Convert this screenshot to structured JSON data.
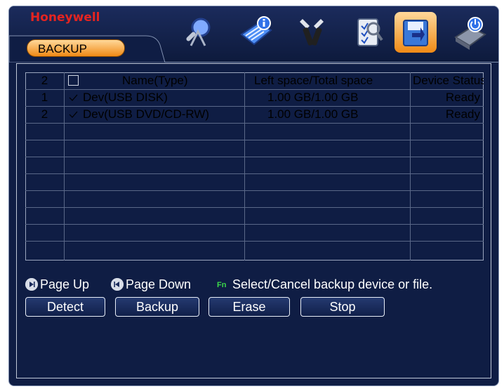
{
  "header": {
    "brand": "Honeywell",
    "tab_label": "BACKUP",
    "icons": [
      "search-icon",
      "info-icon",
      "settings-icon",
      "advanced-icon",
      "backup-icon",
      "shutdown-icon"
    ]
  },
  "table": {
    "header": {
      "index": "2",
      "name": "Name(Type)",
      "space": "Left space/Total space",
      "status": "Device Status"
    },
    "rows": [
      {
        "index": "1",
        "checked": true,
        "name": "Dev(USB DISK)",
        "space": "1.00 GB/1.00 GB",
        "status": "Ready"
      },
      {
        "index": "2",
        "checked": true,
        "name": "Dev(USB DVD/CD-RW)",
        "space": "1.00 GB/1.00 GB",
        "status": "Ready"
      }
    ]
  },
  "hints": {
    "page_up": "Page Up",
    "page_down": "Page Down",
    "fn_label": "Fn",
    "select_hint": "Select/Cancel backup device or file."
  },
  "buttons": {
    "detect": "Detect",
    "backup": "Backup",
    "erase": "Erase",
    "stop": "Stop"
  },
  "colors": {
    "background": "#0f1d44",
    "tab": "#f08a16",
    "brand": "#e52420",
    "grid": "#9aa5bd"
  }
}
